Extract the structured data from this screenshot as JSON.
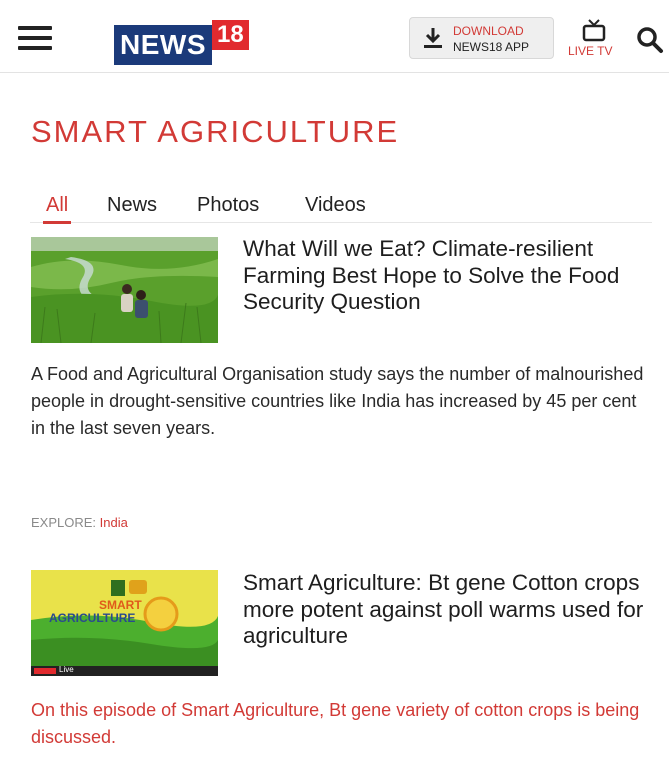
{
  "header": {
    "logo_news": "NEWS",
    "logo_18": "18",
    "download_line1": "DOWNLOAD",
    "download_line2": "NEWS18 APP",
    "live_tv_label": "LIVE TV",
    "icons": [
      "menu-icon",
      "download-icon",
      "tv-icon",
      "search-icon"
    ]
  },
  "section": {
    "title": "SMART AGRICULTURE",
    "tabs": [
      {
        "label": "All",
        "active": true
      },
      {
        "label": "News",
        "active": false
      },
      {
        "label": "Photos",
        "active": false
      },
      {
        "label": "Videos",
        "active": false
      }
    ]
  },
  "articles": [
    {
      "headline": "What Will we Eat? Climate-resilient Farming Best Hope to Solve the Food Security Question",
      "summary": "A Food and Agricultural Organisation study says the number of malnourished people in drought-sensitive countries like India has increased by 45 per cent in the last seven years.",
      "explore_label": "EXPLORE:",
      "explore_link": "India"
    },
    {
      "headline": "Smart Agriculture: Bt gene Cotton crops more potent against poll warms used for agriculture",
      "summary": "On this episode of Smart Agriculture, Bt gene variety of cotton crops is being discussed.",
      "thumb_text_line1": "SMART",
      "thumb_text_line2": "AGRICULTURE",
      "thumb_badge": "Live"
    }
  ],
  "colors": {
    "accent": "#d23a36",
    "logo_blue": "#1b3a7a",
    "logo_red": "#e12a2e",
    "thumb_green": "#4caf2e"
  }
}
